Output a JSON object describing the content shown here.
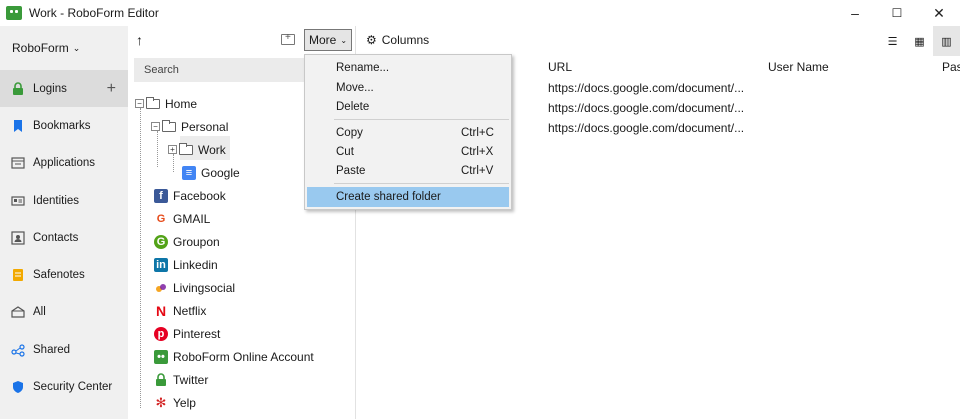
{
  "window": {
    "title": "Work - RoboForm Editor",
    "minimize": "–",
    "maximize": "☐",
    "close": "✕"
  },
  "sidebar": {
    "account": "RoboForm",
    "items": [
      {
        "label": "Logins",
        "icon": "lock-icon",
        "color": "#3a9a3a"
      },
      {
        "label": "Bookmarks",
        "icon": "bookmark-icon",
        "color": "#1a73e8"
      },
      {
        "label": "Applications",
        "icon": "application-icon",
        "color": "#555555"
      },
      {
        "label": "Identities",
        "icon": "identity-card-icon",
        "color": "#555555"
      },
      {
        "label": "Contacts",
        "icon": "contact-icon",
        "color": "#555555"
      },
      {
        "label": "Safenotes",
        "icon": "safenote-icon",
        "color": "#f2a900"
      },
      {
        "label": "All",
        "icon": "all-icon",
        "color": "#555555"
      },
      {
        "label": "Shared",
        "icon": "shared-icon",
        "color": "#1a73e8"
      },
      {
        "label": "Security Center",
        "icon": "shield-icon",
        "color": "#1a73e8"
      }
    ]
  },
  "treepanel": {
    "search_placeholder": "Search",
    "tree": {
      "home": "Home",
      "personal": "Personal",
      "work": "Work",
      "google": "Google",
      "logins": [
        "Facebook",
        "GMAIL",
        "Groupon",
        "Linkedin",
        "Livingsocial",
        "Netflix",
        "Pinterest",
        "RoboForm Online Account",
        "Twitter",
        "Yelp"
      ]
    }
  },
  "toolbar": {
    "more": "More",
    "columns": "Columns"
  },
  "table": {
    "headers": [
      "URL",
      "User Name",
      "Pas"
    ],
    "rows": [
      "https://docs.google.com/document/...",
      "https://docs.google.com/document/...",
      "https://docs.google.com/document/..."
    ]
  },
  "menu": {
    "rename": "Rename...",
    "move": "Move...",
    "delete": "Delete",
    "copy": "Copy",
    "copy_sc": "Ctrl+C",
    "cut": "Cut",
    "cut_sc": "Ctrl+X",
    "paste": "Paste",
    "paste_sc": "Ctrl+V",
    "shared": "Create shared folder"
  }
}
